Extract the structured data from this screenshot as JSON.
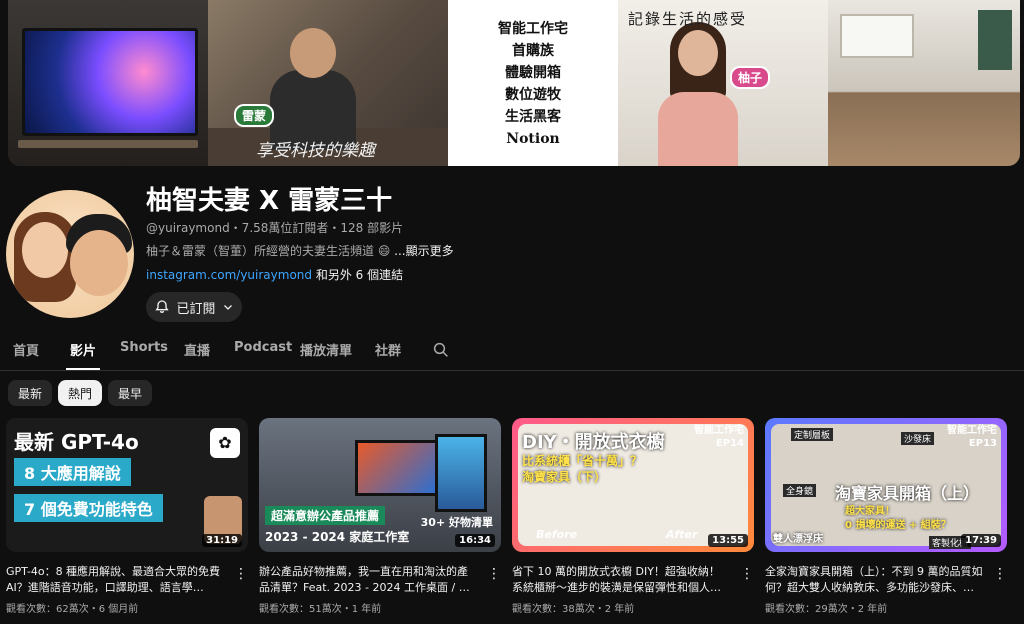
{
  "banner": {
    "tag_ray": "雷蒙",
    "tag_yuzu": "柚子",
    "tagline_left": "享受科技的樂趣",
    "tagline_right": "記錄生活的感受",
    "list": [
      "智能工作宅",
      "首購族",
      "體驗開箱",
      "數位遊牧",
      "生活黑客",
      "Notion"
    ]
  },
  "channel": {
    "name": "柚智夫妻 X 雷蒙三十",
    "meta": "@yuiraymond・7.58萬位訂閱者・128 部影片",
    "desc": "柚子＆雷蒙（智董）所經營的夫妻生活頻道 😄 ",
    "desc_more": "...顯示更多",
    "link_url": "instagram.com/yuiraymond",
    "link_suffix": " 和另外 6 個連結",
    "subscribe_label": "已訂閱"
  },
  "tabs": [
    {
      "label": "首頁"
    },
    {
      "label": "影片"
    },
    {
      "label": "Shorts"
    },
    {
      "label": "直播"
    },
    {
      "label": "Podcast"
    },
    {
      "label": "播放清單"
    },
    {
      "label": "社群"
    }
  ],
  "chips": [
    {
      "label": "最新"
    },
    {
      "label": "熱門"
    },
    {
      "label": "最早"
    }
  ],
  "videos": [
    {
      "title": "GPT-4o：8 種應用解說、最適合大眾的免費 AI？進階語音功能，口譯助理、語言學習、...",
      "meta": "觀看次數：62萬次・6 個月前",
      "duration": "31:19",
      "thumb": {
        "line1": "最新 GPT-4o",
        "line2": "8 大應用解說",
        "line3": "7 個免費功能特色"
      }
    },
    {
      "title": "辦公產品好物推薦，我一直在用和淘汰的產品清單？Feat. 2023 - 2024 工作桌面 / 家庭工...",
      "meta": "觀看次數：51萬次・1 年前",
      "duration": "16:34",
      "thumb": {
        "line1": "超滿意辦公產品推薦",
        "line2": "30+ 好物清單",
        "line3": "2023 - 2024 家庭工作室"
      }
    },
    {
      "title": "省下 10 萬的開放式衣櫥 DIY！超強收納！系統櫃掰～進步的裝潢是保留彈性和個人化 | ...",
      "meta": "觀看次數：38萬次・2 年前",
      "duration": "13:55",
      "thumb": {
        "line1": "DIY・開放式衣櫥",
        "line2": "比系統櫃「省十萬」？",
        "line3": "淘寶家具（下）",
        "ep": "智能工作宅",
        "ep_num": "EP14",
        "before": "Before",
        "after": "After"
      }
    },
    {
      "title": "全家淘寶家具開箱（上）：不到 9 萬的品質如何？超大雙人收納敦床、多功能沙發床、折...",
      "meta": "觀看次數：29萬次・2 年前",
      "duration": "17:39",
      "thumb": {
        "line1": "淘寶家具開箱（上）",
        "line2": "超大家具！",
        "line3": "0 損壞的運送 + 組裝？",
        "ep": "智能工作宅",
        "ep_num": "EP13",
        "l1": "定制層板",
        "l2": "全身鏡",
        "l3": "沙發床",
        "l4": "雙人漂浮床",
        "l5": "客製化櫃"
      }
    }
  ]
}
